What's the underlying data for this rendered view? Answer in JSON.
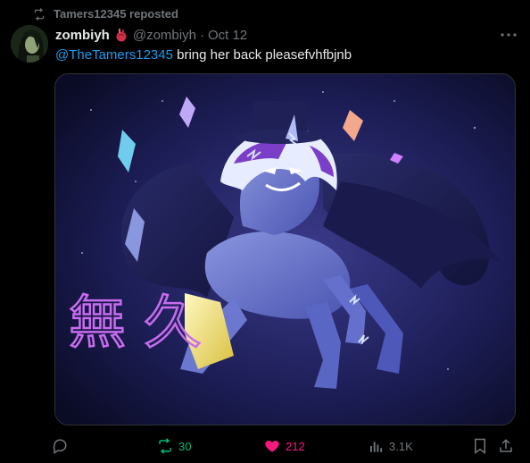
{
  "repost_banner": {
    "icon": "repost-icon",
    "text": "Tamers12345 reposted"
  },
  "post": {
    "author": {
      "display_name": "zombiyh",
      "badge_emoji": "anatomical-heart-icon",
      "handle": "@zombiyh"
    },
    "separator": "·",
    "date": "Oct 12",
    "text": {
      "mention": "@TheTamers12345",
      "body": " bring her back pleasefvhfbjnb"
    },
    "media": {
      "kanji": "無 久"
    }
  },
  "actions": {
    "reply": {
      "icon": "reply-icon",
      "count": ""
    },
    "repost": {
      "icon": "repost-icon",
      "count": "30",
      "color": "#00ba7c"
    },
    "like": {
      "icon": "heart-filled-icon",
      "count": "212",
      "color": "#f91880"
    },
    "views": {
      "icon": "views-bar-icon",
      "count": "3.1K"
    },
    "bookmark": {
      "icon": "bookmark-icon"
    },
    "share": {
      "icon": "share-icon"
    }
  },
  "colors": {
    "background": "#000000",
    "text_primary": "#e7e9ea",
    "text_secondary": "#71767b",
    "link": "#1d9bf0"
  }
}
